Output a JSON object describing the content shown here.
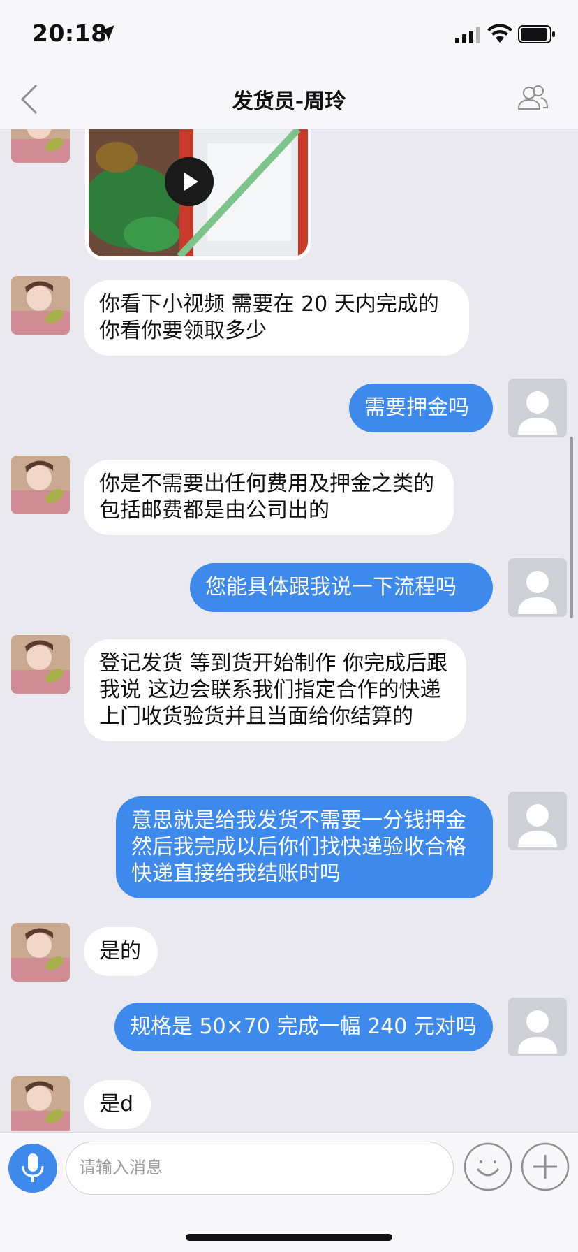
{
  "status_bar": {
    "time": "20:18",
    "icons": [
      "location-arrow-icon",
      "signal-icon",
      "wifi-icon",
      "battery-icon"
    ]
  },
  "nav": {
    "title": "发货员-周玲",
    "left_icon": "back-chevron-icon",
    "right_icon": "contacts-icon"
  },
  "colors": {
    "outgoing_bubble": "#3d89ec",
    "incoming_bubble": "#ffffff",
    "background": "#e9e9ef"
  },
  "messages": [
    {
      "from": "them",
      "type": "video"
    },
    {
      "from": "them",
      "text": "你看下小视频 需要在 20 天内完成的你看你要领取多少"
    },
    {
      "from": "me",
      "text": "需要押金吗"
    },
    {
      "from": "them",
      "text": "你是不需要出任何费用及押金之类的 包括邮费都是由公司出的"
    },
    {
      "from": "me",
      "text": "您能具体跟我说一下流程吗"
    },
    {
      "from": "them",
      "text": "登记发货 等到货开始制作 你完成后跟我说 这边会联系我们指定合作的快递上门收货验货并且当面给你结算的"
    },
    {
      "from": "me",
      "text": "意思就是给我发货不需要一分钱押金 然后我完成以后你们找快递验收合格快递直接给我结账时吗"
    },
    {
      "from": "them",
      "text": "是的"
    },
    {
      "from": "me",
      "text": "规格是 50×70 完成一幅 240 元对吗"
    },
    {
      "from": "them",
      "text": "是d"
    }
  ],
  "input": {
    "placeholder": "请输入消息",
    "icons": [
      "microphone-icon",
      "emoji-icon",
      "plus-icon"
    ]
  }
}
